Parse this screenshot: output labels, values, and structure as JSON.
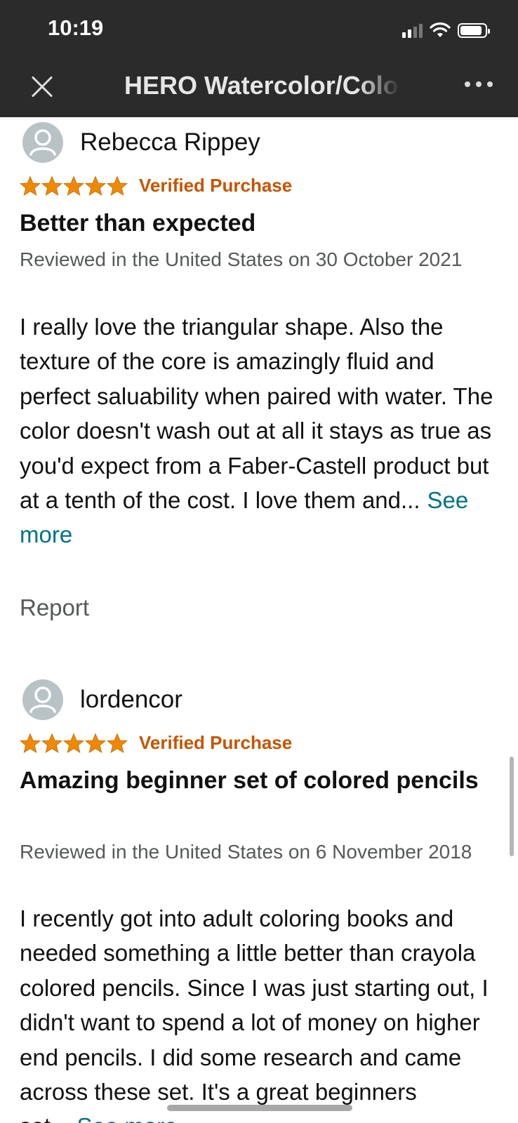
{
  "status_bar": {
    "time": "10:19"
  },
  "nav": {
    "title": "HERO Watercolor/Colored Pencils"
  },
  "colors": {
    "star": "#f08804",
    "verified": "#c45500",
    "link": "#007185",
    "meta": "#565959"
  },
  "reviews": [
    {
      "reviewer": "Rebecca Rippey",
      "rating": 5,
      "verified": "Verified Purchase",
      "title": "Better than expected",
      "meta": "Reviewed in the United States on 30 October 2021",
      "body": "I really love the triangular shape. Also the texture of the core is amazingly fluid and perfect saluability when paired with water. The color doesn't wash out at all it stays as true as you'd expect from a Faber-Castell product but at a tenth of the cost. I love them and...",
      "see_more": "See more",
      "report": "Report"
    },
    {
      "reviewer": "lordencor",
      "rating": 5,
      "verified": "Verified Purchase",
      "title": "Amazing beginner set of colored pencils",
      "meta": "Reviewed in the United States on 6 November 2018",
      "body": "I recently got into adult coloring books and needed something a little better than crayola colored pencils. Since I was just starting out, I didn't want to spend a lot of money on higher end pencils. I did some research and came across these set. It's a great beginners set...",
      "see_more": "See more"
    }
  ]
}
